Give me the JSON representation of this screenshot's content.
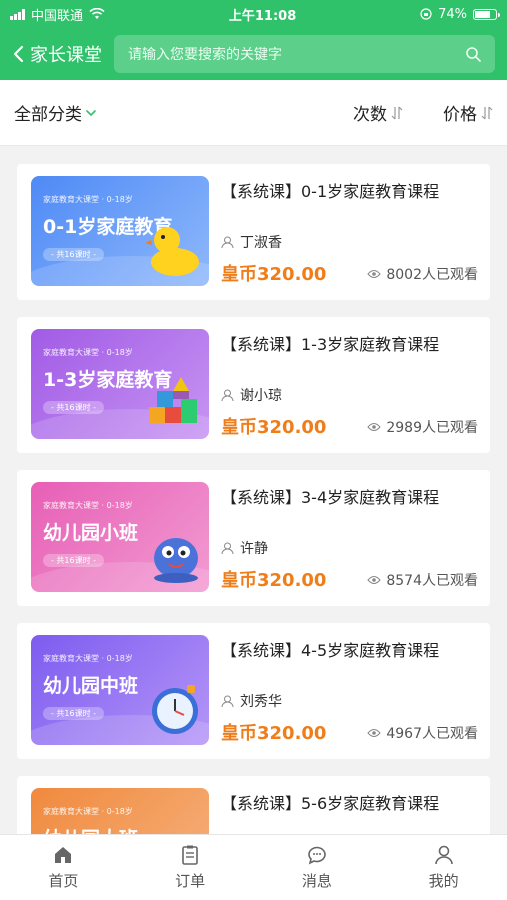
{
  "status": {
    "carrier": "中国联通",
    "time": "上午11:08",
    "battery": "74%"
  },
  "header": {
    "back_label": "家长课堂",
    "search_placeholder": "请输入您要搜索的关键字"
  },
  "filters": {
    "category": "全部分类",
    "times": "次数",
    "price": "价格"
  },
  "courses": [
    {
      "title": "【系统课】0-1岁家庭教育课程",
      "teacher": "丁淑香",
      "price": "皇币320.00",
      "views": "8002人已观看",
      "thumb_sub": "家庭教育大课堂 · 0-18岁",
      "thumb_title": "0-1岁家庭教育",
      "thumb_pill": "- 共16课时 -",
      "color_a": "#4e8af6",
      "color_b": "#8fb8fb"
    },
    {
      "title": "【系统课】1-3岁家庭教育课程",
      "teacher": "谢小琼",
      "price": "皇币320.00",
      "views": "2989人已观看",
      "thumb_sub": "家庭教育大课堂 · 0-18岁",
      "thumb_title": "1-3岁家庭教育",
      "thumb_pill": "- 共16课时 -",
      "color_a": "#a15be6",
      "color_b": "#c794f2"
    },
    {
      "title": "【系统课】3-4岁家庭教育课程",
      "teacher": "许静",
      "price": "皇币320.00",
      "views": "8574人已观看",
      "thumb_sub": "家庭教育大课堂 · 0-18岁",
      "thumb_title": "幼儿园小班",
      "thumb_pill": "- 共16课时 -",
      "color_a": "#e75fb6",
      "color_b": "#f29bd2"
    },
    {
      "title": "【系统课】4-5岁家庭教育课程",
      "teacher": "刘秀华",
      "price": "皇币320.00",
      "views": "4967人已观看",
      "thumb_sub": "家庭教育大课堂 · 0-18岁",
      "thumb_title": "幼儿园中班",
      "thumb_pill": "- 共16课时 -",
      "color_a": "#7d5cf0",
      "color_b": "#b596f7"
    },
    {
      "title": "【系统课】5-6岁家庭教育课程",
      "teacher": "",
      "price": "",
      "views": "",
      "thumb_sub": "家庭教育大课堂 · 0-18岁",
      "thumb_title": "幼儿园大班",
      "thumb_pill": "",
      "color_a": "#f08a3e",
      "color_b": "#f6b27e"
    }
  ],
  "tabs": [
    {
      "label": "首页",
      "icon": "home-icon"
    },
    {
      "label": "订单",
      "icon": "order-icon"
    },
    {
      "label": "消息",
      "icon": "message-icon"
    },
    {
      "label": "我的",
      "icon": "profile-icon"
    }
  ],
  "colors": {
    "brand": "#2fc26a",
    "price": "#ef7d1a",
    "accent_chevron": "#2fc26a"
  }
}
